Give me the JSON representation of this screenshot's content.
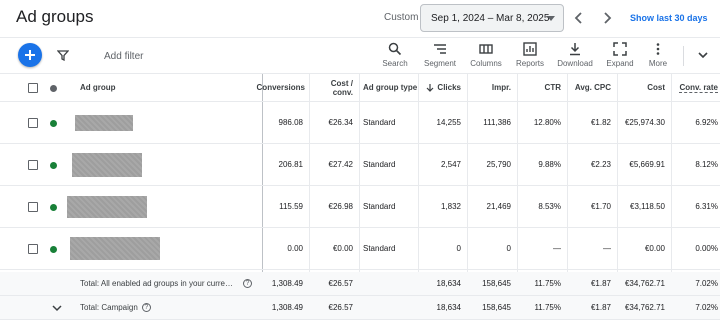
{
  "header": {
    "title": "Ad groups",
    "custom_label": "Custom",
    "date_range": "Sep 1, 2024 – Mar 8, 2025",
    "show_last": "Show last 30 days"
  },
  "toolbar": {
    "add_filter": "Add filter",
    "tools": [
      {
        "label": "Search",
        "icon": "search-icon"
      },
      {
        "label": "Segment",
        "icon": "segment-icon"
      },
      {
        "label": "Columns",
        "icon": "columns-icon"
      },
      {
        "label": "Reports",
        "icon": "reports-icon"
      },
      {
        "label": "Download",
        "icon": "download-icon"
      },
      {
        "label": "Expand",
        "icon": "expand-icon"
      },
      {
        "label": "More",
        "icon": "more-icon"
      }
    ]
  },
  "table": {
    "headers": {
      "ad_group": "Ad group",
      "conversions": "Conversions",
      "cost_conv_1": "Cost /",
      "cost_conv_2": "conv.",
      "ad_group_type": "Ad group type",
      "clicks": "Clicks",
      "impr": "Impr.",
      "ctr": "CTR",
      "avg_cpc": "Avg. CPC",
      "cost": "Cost",
      "conv_rate": "Conv. rate"
    },
    "rows": [
      {
        "conversions": "986.08",
        "cost_conv": "€26.34",
        "type": "Standard",
        "clicks": "14,255",
        "impr": "111,386",
        "ctr": "12.80%",
        "avg_cpc": "€1.82",
        "cost": "€25,974.30",
        "conv_rate": "6.92%"
      },
      {
        "conversions": "206.81",
        "cost_conv": "€27.42",
        "type": "Standard",
        "clicks": "2,547",
        "impr": "25,790",
        "ctr": "9.88%",
        "avg_cpc": "€2.23",
        "cost": "€5,669.91",
        "conv_rate": "8.12%"
      },
      {
        "conversions": "115.59",
        "cost_conv": "€26.98",
        "type": "Standard",
        "clicks": "1,832",
        "impr": "21,469",
        "ctr": "8.53%",
        "avg_cpc": "€1.70",
        "cost": "€3,118.50",
        "conv_rate": "6.31%"
      },
      {
        "conversions": "0.00",
        "cost_conv": "€0.00",
        "type": "Standard",
        "clicks": "0",
        "impr": "0",
        "ctr": "—",
        "avg_cpc": "—",
        "cost": "€0.00",
        "conv_rate": "0.00%"
      }
    ],
    "totals": [
      {
        "label": "Total: All enabled ad groups in your curre…",
        "conversions": "1,308.49",
        "cost_conv": "€26.57",
        "clicks": "18,634",
        "impr": "158,645",
        "ctr": "11.75%",
        "avg_cpc": "€1.87",
        "cost": "€34,762.71",
        "conv_rate": "7.02%"
      },
      {
        "label": "Total: Campaign",
        "conversions": "1,308.49",
        "cost_conv": "€26.57",
        "clicks": "18,634",
        "impr": "158,645",
        "ctr": "11.75%",
        "avg_cpc": "€1.87",
        "cost": "€34,762.71",
        "conv_rate": "7.02%"
      }
    ]
  },
  "colors": {
    "accent": "#1a73e8",
    "status_enabled": "#188038"
  }
}
